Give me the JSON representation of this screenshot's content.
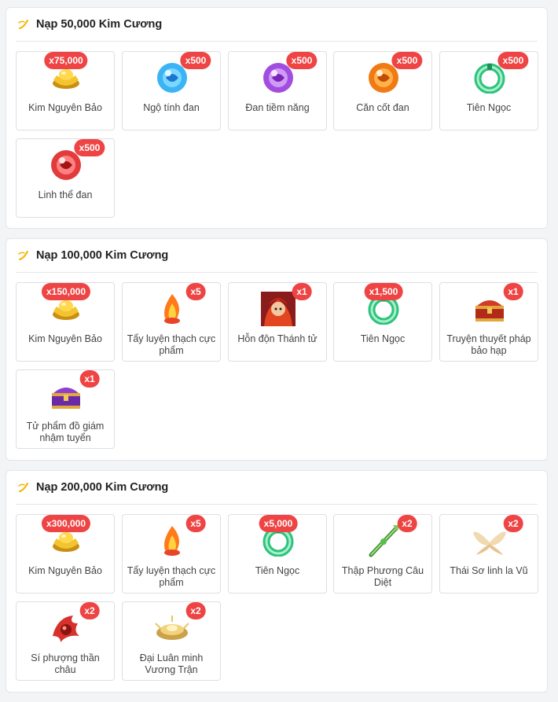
{
  "sections": [
    {
      "title": "Nạp 50,000 Kim Cương",
      "items": [
        {
          "label": "Kim Nguyên Bảo",
          "qty": "x75,000",
          "icon": "gold-ingot-icon"
        },
        {
          "label": "Ngộ tính đan",
          "qty": "x500",
          "icon": "blue-orb-icon"
        },
        {
          "label": "Đan tiềm năng",
          "qty": "x500",
          "icon": "purple-orb-icon"
        },
        {
          "label": "Căn cốt đan",
          "qty": "x500",
          "icon": "orange-orb-icon"
        },
        {
          "label": "Tiên Ngọc",
          "qty": "x500",
          "icon": "jade-ring-icon"
        },
        {
          "label": "Linh thể đan",
          "qty": "x500",
          "icon": "red-orb-icon"
        }
      ]
    },
    {
      "title": "Nạp 100,000 Kim Cương",
      "items": [
        {
          "label": "Kim Nguyên Bảo",
          "qty": "x150,000",
          "icon": "gold-ingot-icon"
        },
        {
          "label": "Tẩy luyện thạch cực phẩm",
          "qty": "x5",
          "icon": "flame-stone-icon"
        },
        {
          "label": "Hỗn độn Thánh tử",
          "qty": "x1",
          "icon": "character-portrait-icon"
        },
        {
          "label": "Tiên Ngọc",
          "qty": "x1,500",
          "icon": "jade-ring-icon"
        },
        {
          "label": "Truyện thuyết pháp bảo hạp",
          "qty": "x1",
          "icon": "red-treasure-chest-icon"
        },
        {
          "label": "Tử phẩm đồ giám nhậm tuyển",
          "qty": "x1",
          "icon": "purple-treasure-chest-icon"
        }
      ]
    },
    {
      "title": "Nạp 200,000 Kim Cương",
      "items": [
        {
          "label": "Kim Nguyên Bảo",
          "qty": "x300,000",
          "icon": "gold-ingot-icon"
        },
        {
          "label": "Tẩy luyện thạch cực phẩm",
          "qty": "x5",
          "icon": "flame-stone-icon"
        },
        {
          "label": "Tiên Ngọc",
          "qty": "x5,000",
          "icon": "jade-ring-icon"
        },
        {
          "label": "Thập Phương Câu Diệt",
          "qty": "x2",
          "icon": "green-spear-icon"
        },
        {
          "label": "Thái Sơ linh la Vũ",
          "qty": "x2",
          "icon": "feather-wings-icon"
        },
        {
          "label": "Sí phượng thần châu",
          "qty": "x2",
          "icon": "phoenix-bead-icon"
        },
        {
          "label": "Đại Luân minh Vương Trận",
          "qty": "x2",
          "icon": "golden-wheel-icon"
        }
      ]
    }
  ],
  "colors": {
    "badge": "#ef4444",
    "accent": "#f5b400"
  }
}
